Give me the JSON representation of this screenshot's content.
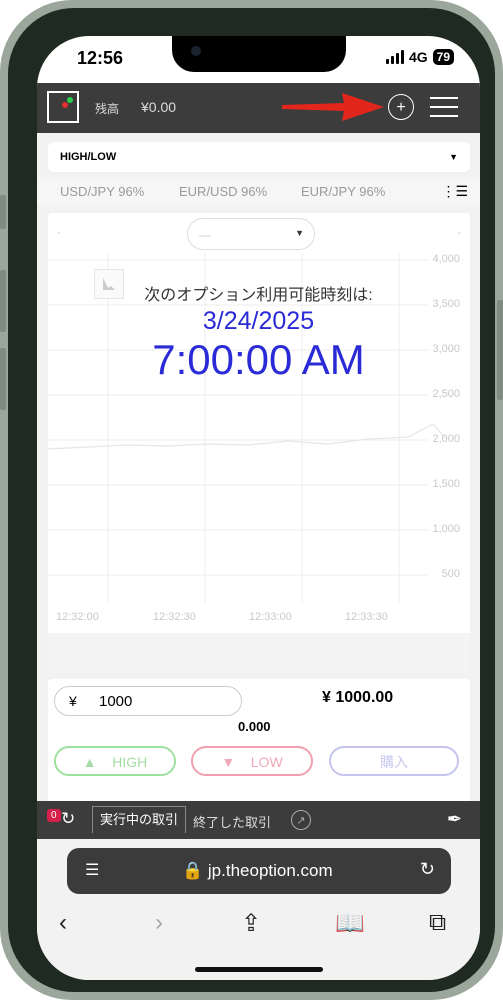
{
  "status_bar": {
    "time": "12:56",
    "network": "4G",
    "battery": "79"
  },
  "header": {
    "balance_label": "残高",
    "balance_value": "¥0.00",
    "plus_symbol": "+"
  },
  "trade_type": {
    "selected": "HIGH/LOW"
  },
  "assets": [
    "USD/JPY 96%",
    "EUR/USD 96%",
    "EUR/JPY 96%"
  ],
  "chart": {
    "dropdown_value": "—",
    "left_dash": "-",
    "right_dash": "-",
    "y_ticks": [
      "4,000",
      "3,500",
      "3,000",
      "2,500",
      "2,000",
      "1,500",
      "1,000",
      "500"
    ],
    "x_ticks": [
      "12:32:00",
      "12:32:30",
      "12:33:00",
      "12:33:30"
    ]
  },
  "chart_data": {
    "type": "line",
    "x": [
      "12:32:00",
      "12:32:30",
      "12:33:00",
      "12:33:30"
    ],
    "ylim": [
      500,
      4000
    ],
    "grid": true
  },
  "overlay": {
    "label": "次のオプション利用可能時刻は:",
    "date": "3/24/2025",
    "time": "7:00:00 AM"
  },
  "trade": {
    "currency": "¥",
    "amount": "1000",
    "payout": "¥ 1000.00",
    "rate": "0.000",
    "high_label": "HIGH",
    "low_label": "LOW",
    "buy_label": "購入"
  },
  "tabs": {
    "badge": "0",
    "active": "実行中の取引",
    "done": "終了した取引"
  },
  "browser": {
    "url": "jp.theoption.com"
  },
  "colors": {
    "accent_blue": "#2a2ad6",
    "header_bg": "#3c3c3c",
    "arrow_red": "#e3261c"
  }
}
